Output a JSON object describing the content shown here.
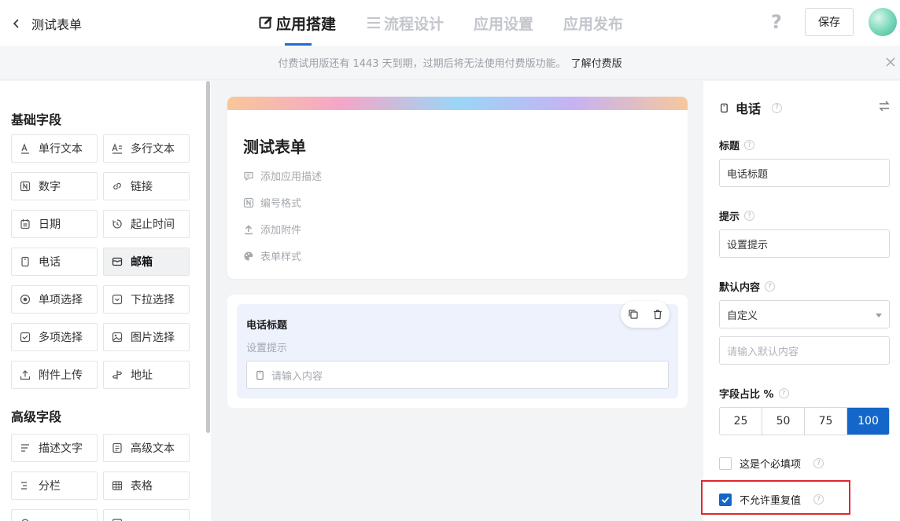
{
  "header": {
    "back_title": "测试表单",
    "tabs": [
      {
        "label": "应用搭建",
        "active": true,
        "icon": "edit-icon"
      },
      {
        "label": "流程设计",
        "active": false,
        "icon": "flow-icon"
      },
      {
        "label": "应用设置",
        "active": false
      },
      {
        "label": "应用发布",
        "active": false
      }
    ],
    "help_glyph": "?",
    "save_label": "保存"
  },
  "notice": {
    "text": "付费试用版还有 1443 天到期，过期后将无法使用付费版功能。",
    "link": "了解付费版"
  },
  "sidebar": {
    "basic_title": "基础字段",
    "basic_fields": [
      {
        "label": "单行文本",
        "icon": "single-line-text-icon"
      },
      {
        "label": "多行文本",
        "icon": "multi-line-text-icon"
      },
      {
        "label": "数字",
        "icon": "number-icon"
      },
      {
        "label": "链接",
        "icon": "link-icon"
      },
      {
        "label": "日期",
        "icon": "date-icon"
      },
      {
        "label": "起止时间",
        "icon": "time-range-icon"
      },
      {
        "label": "电话",
        "icon": "phone-icon"
      },
      {
        "label": "邮箱",
        "icon": "mail-icon",
        "selected": true
      },
      {
        "label": "单项选择",
        "icon": "radio-icon"
      },
      {
        "label": "下拉选择",
        "icon": "dropdown-icon"
      },
      {
        "label": "多项选择",
        "icon": "checkbox-icon"
      },
      {
        "label": "图片选择",
        "icon": "image-icon"
      },
      {
        "label": "附件上传",
        "icon": "upload-icon"
      },
      {
        "label": "地址",
        "icon": "address-icon"
      }
    ],
    "advanced_title": "高级字段",
    "advanced_fields": [
      {
        "label": "描述文字",
        "icon": "description-icon"
      },
      {
        "label": "高级文本",
        "icon": "rich-text-icon"
      },
      {
        "label": "分栏",
        "icon": "columns-icon"
      },
      {
        "label": "表格",
        "icon": "table-icon"
      }
    ]
  },
  "form": {
    "title": "测试表单",
    "options": [
      {
        "label": "添加应用描述",
        "icon": "comment-icon"
      },
      {
        "label": "编号格式",
        "icon": "number-format-icon"
      },
      {
        "label": "添加附件",
        "icon": "upload-icon"
      },
      {
        "label": "表单样式",
        "icon": "palette-icon"
      }
    ],
    "field": {
      "title": "电话标题",
      "hint": "设置提示",
      "placeholder": "请输入内容"
    }
  },
  "props": {
    "field_type": "电话",
    "title_label": "标题",
    "title_value": "电话标题",
    "hint_label": "提示",
    "hint_value": "设置提示",
    "default_label": "默认内容",
    "default_select": "自定义",
    "default_placeholder": "请输入默认内容",
    "ratio_label": "字段占比 %",
    "ratio_options": [
      "25",
      "50",
      "75",
      "100"
    ],
    "ratio_selected": "100",
    "required_label": "这是个必填项",
    "required_checked": false,
    "no_repeat_label": "不允许重复值",
    "no_repeat_checked": true
  },
  "colors": {
    "accent": "#1467c8",
    "highlight": "#e0282e"
  }
}
